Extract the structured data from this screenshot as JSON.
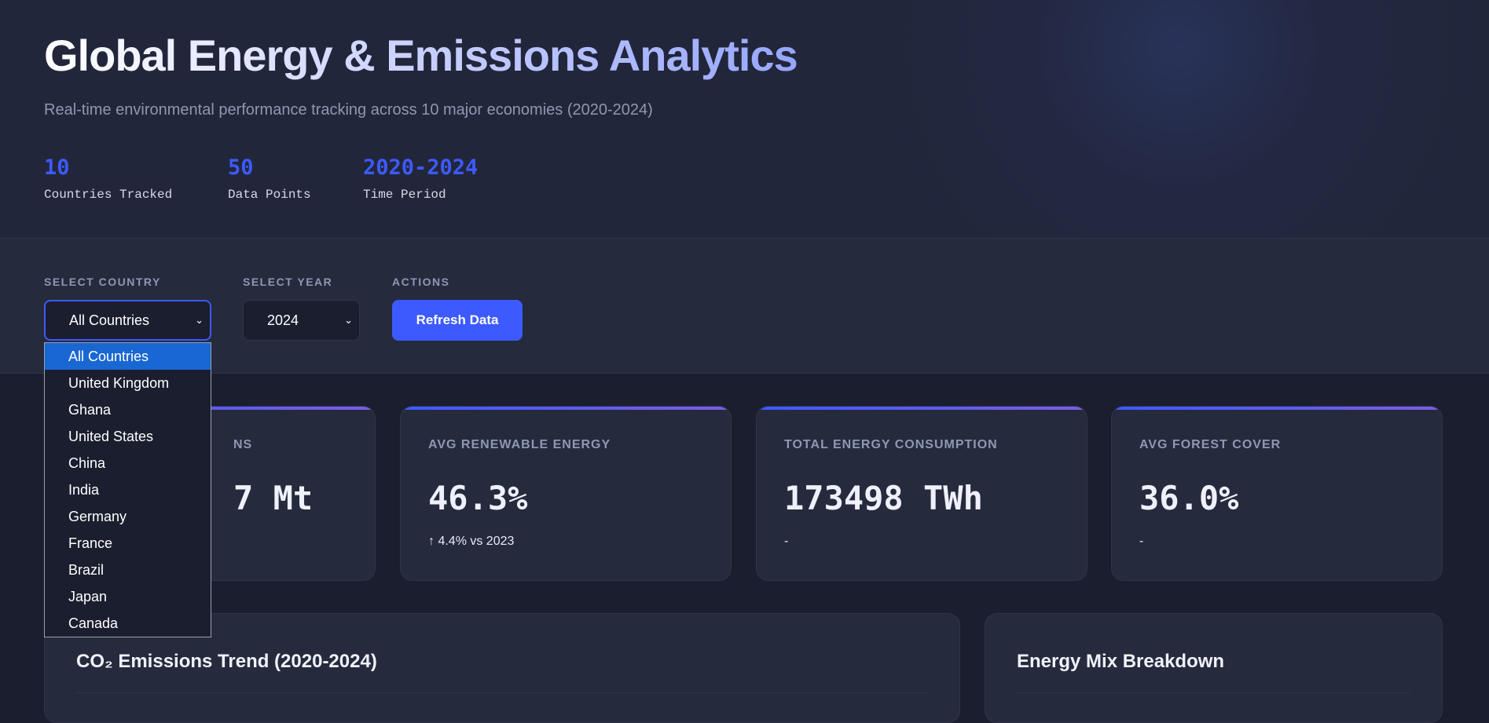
{
  "header": {
    "title": "Global Energy & Emissions Analytics",
    "subtitle": "Real-time environmental performance tracking across 10 major economies (2020-2024)",
    "stats": [
      {
        "value": "10",
        "label": "Countries Tracked"
      },
      {
        "value": "50",
        "label": "Data Points"
      },
      {
        "value": "2020-2024",
        "label": "Time Period"
      }
    ]
  },
  "controls": {
    "country_label": "SELECT COUNTRY",
    "country_value": "All Countries",
    "year_label": "SELECT YEAR",
    "year_value": "2024",
    "actions_label": "ACTIONS",
    "refresh_label": "Refresh Data"
  },
  "country_options": [
    "All Countries",
    "United Kingdom",
    "Ghana",
    "United States",
    "China",
    "India",
    "Germany",
    "France",
    "Brazil",
    "Japan",
    "Canada"
  ],
  "cards": [
    {
      "label": "NS",
      "value": "7 Mt",
      "sub": ""
    },
    {
      "label": "AVG RENEWABLE ENERGY",
      "value": "46.3%",
      "sub": "↑ 4.4% vs 2023"
    },
    {
      "label": "TOTAL ENERGY CONSUMPTION",
      "value": "173498 TWh",
      "sub": "-"
    },
    {
      "label": "AVG FOREST COVER",
      "value": "36.0%",
      "sub": "-"
    }
  ],
  "panels": {
    "trend_title": "CO₂ Emissions Trend (2020-2024)",
    "mix_title": "Energy Mix Breakdown"
  },
  "colors": {
    "accent": "#3d5afe",
    "background": "#1b1e2e",
    "card": "#252a3d",
    "selected_option": "#1967d2"
  }
}
